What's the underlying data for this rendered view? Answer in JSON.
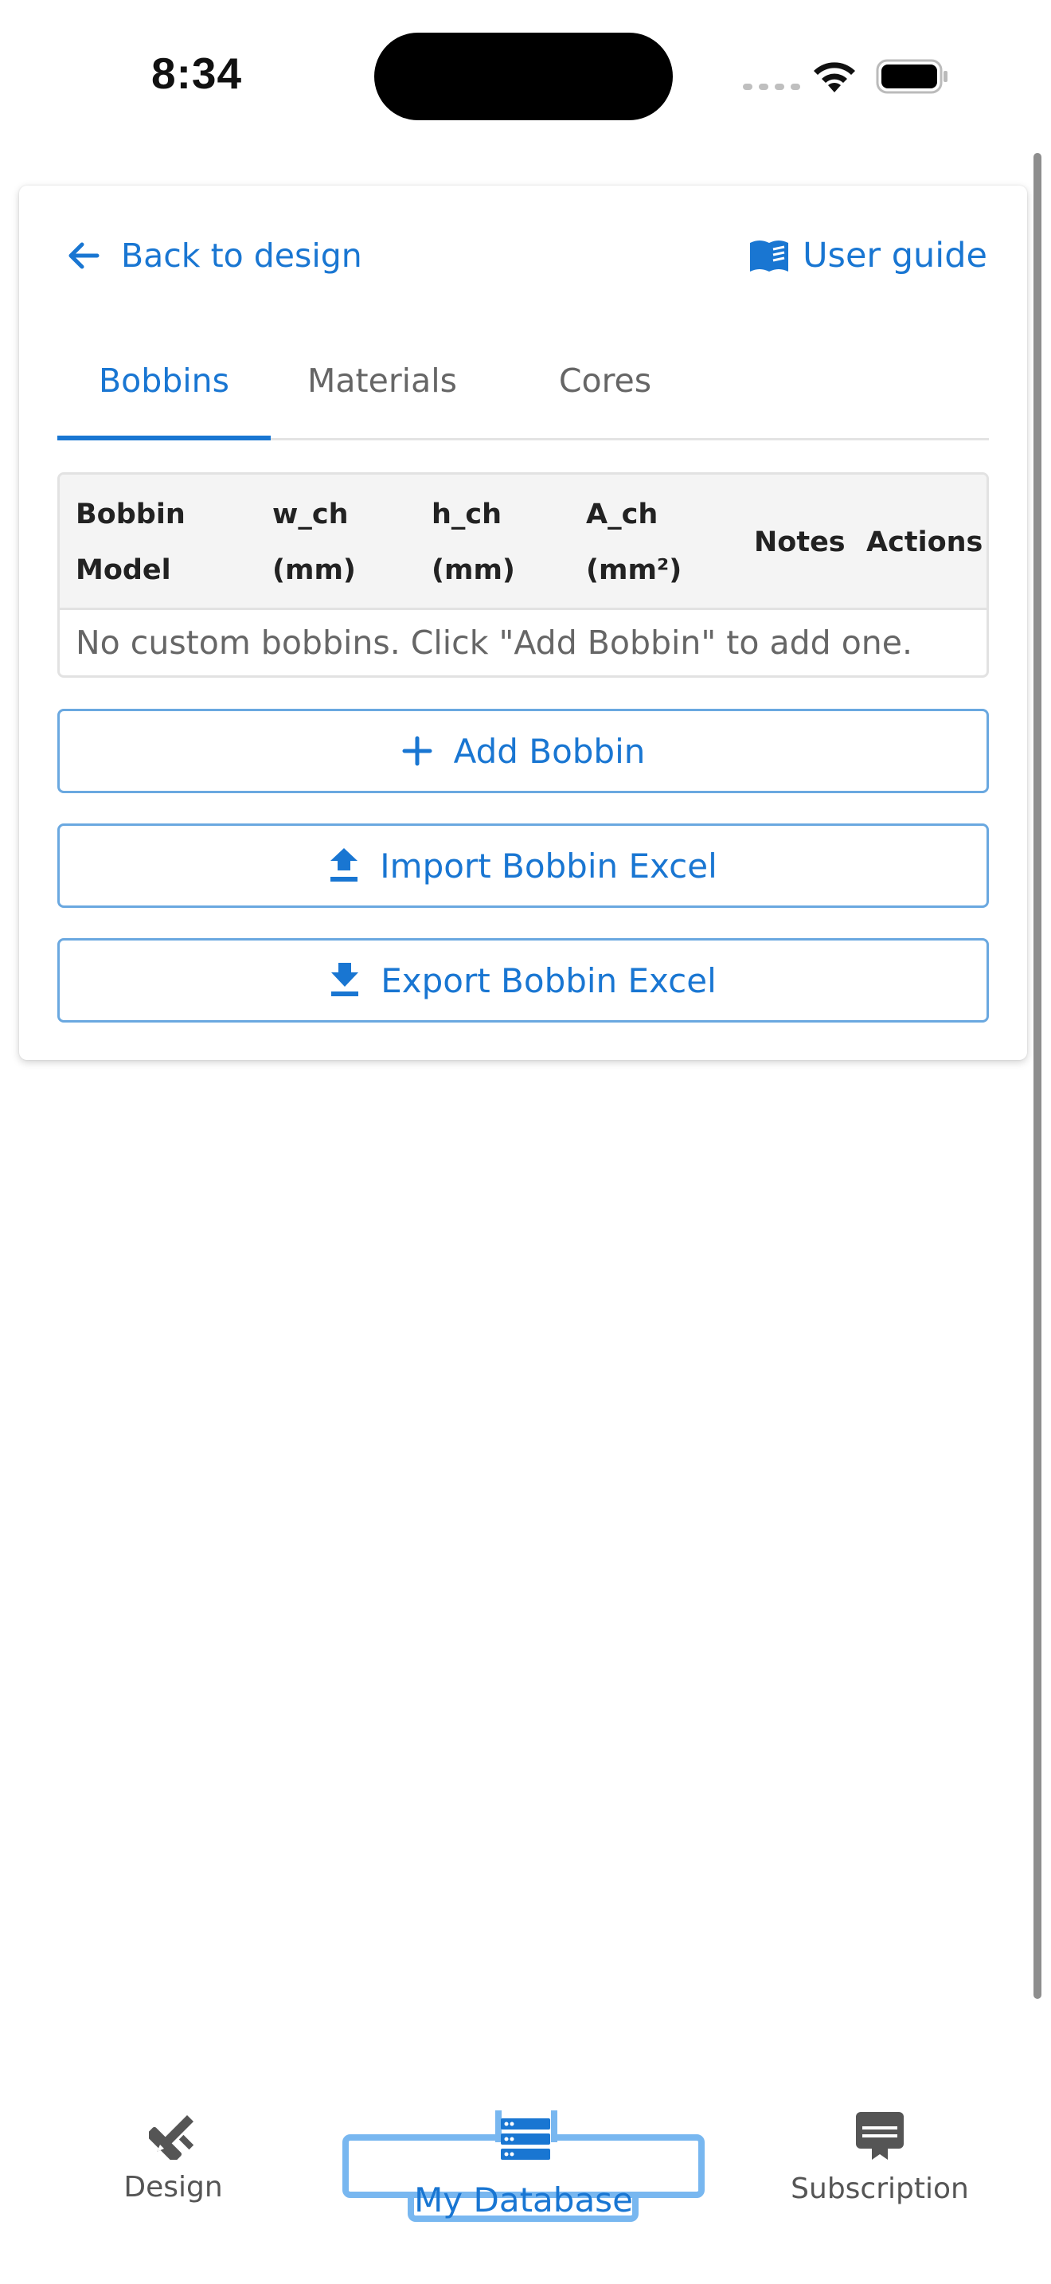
{
  "status_bar": {
    "time": "8:34"
  },
  "header": {
    "back_label": "Back to design",
    "guide_label": "User guide"
  },
  "tabs": [
    {
      "label": "Bobbins",
      "active": true
    },
    {
      "label": "Materials",
      "active": false
    },
    {
      "label": "Cores",
      "active": false
    }
  ],
  "table": {
    "columns": [
      {
        "line1": "Bobbin",
        "line2": "Model"
      },
      {
        "line1": "w_ch",
        "line2": "(mm)"
      },
      {
        "line1": "h_ch",
        "line2": "(mm)"
      },
      {
        "line1": "A_ch",
        "line2": "(mm²)"
      },
      {
        "line1": "Notes",
        "line2": ""
      },
      {
        "line1": "Actions",
        "line2": ""
      }
    ],
    "empty_message": "No custom bobbins. Click \"Add Bobbin\" to add one."
  },
  "buttons": {
    "add": "Add Bobbin",
    "import": "Import Bobbin Excel",
    "export": "Export Bobbin Excel"
  },
  "bottom_nav": [
    {
      "label": "Design",
      "icon": "design-tools-icon",
      "active": false
    },
    {
      "label": "My Database",
      "icon": "database-icon",
      "active": true
    },
    {
      "label": "Subscription",
      "icon": "subscription-icon",
      "active": false
    }
  ],
  "colors": {
    "accent": "#1976d2",
    "active_outline": "#78b7f0",
    "muted_text": "#666666"
  }
}
